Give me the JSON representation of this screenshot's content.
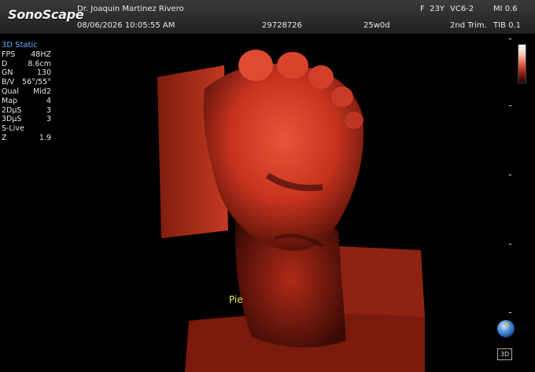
{
  "header": {
    "brand": "SonoScape",
    "doctor": "Dr. Joaquin Martinez Rivero",
    "datetime": "08/06/2026 10:05:55 AM",
    "patient_id": "29728726",
    "gestational_age": "25w0d",
    "sex_age": "F  23Y",
    "probe": "VC6-2",
    "mi": "MI 0.6",
    "preset": "2nd Trim.",
    "tib": "TIB 0.1"
  },
  "params": {
    "mode": "3D Static",
    "rows": [
      {
        "label": "FPS",
        "value": "48HZ"
      },
      {
        "label": "D",
        "value": "8.6cm"
      },
      {
        "label": "GN",
        "value": "130"
      },
      {
        "label": "B/V",
        "value": "56°/55°"
      },
      {
        "label": "Qual",
        "value": "Mid2"
      },
      {
        "label": "Map",
        "value": "4"
      },
      {
        "label": "2DμS",
        "value": "3"
      },
      {
        "label": "3DμS",
        "value": "3"
      },
      {
        "label": "S-Live",
        "value": ""
      },
      {
        "label": "Z",
        "value": "1.9"
      }
    ]
  },
  "annotation": {
    "label": "Pie",
    "color": "#f0e45a"
  },
  "orientation": {
    "button_label": "3D"
  },
  "colors": {
    "render_primary": "#c8331f",
    "render_shadow": "#3a0a05",
    "mode_text": "#6fb0ff"
  }
}
